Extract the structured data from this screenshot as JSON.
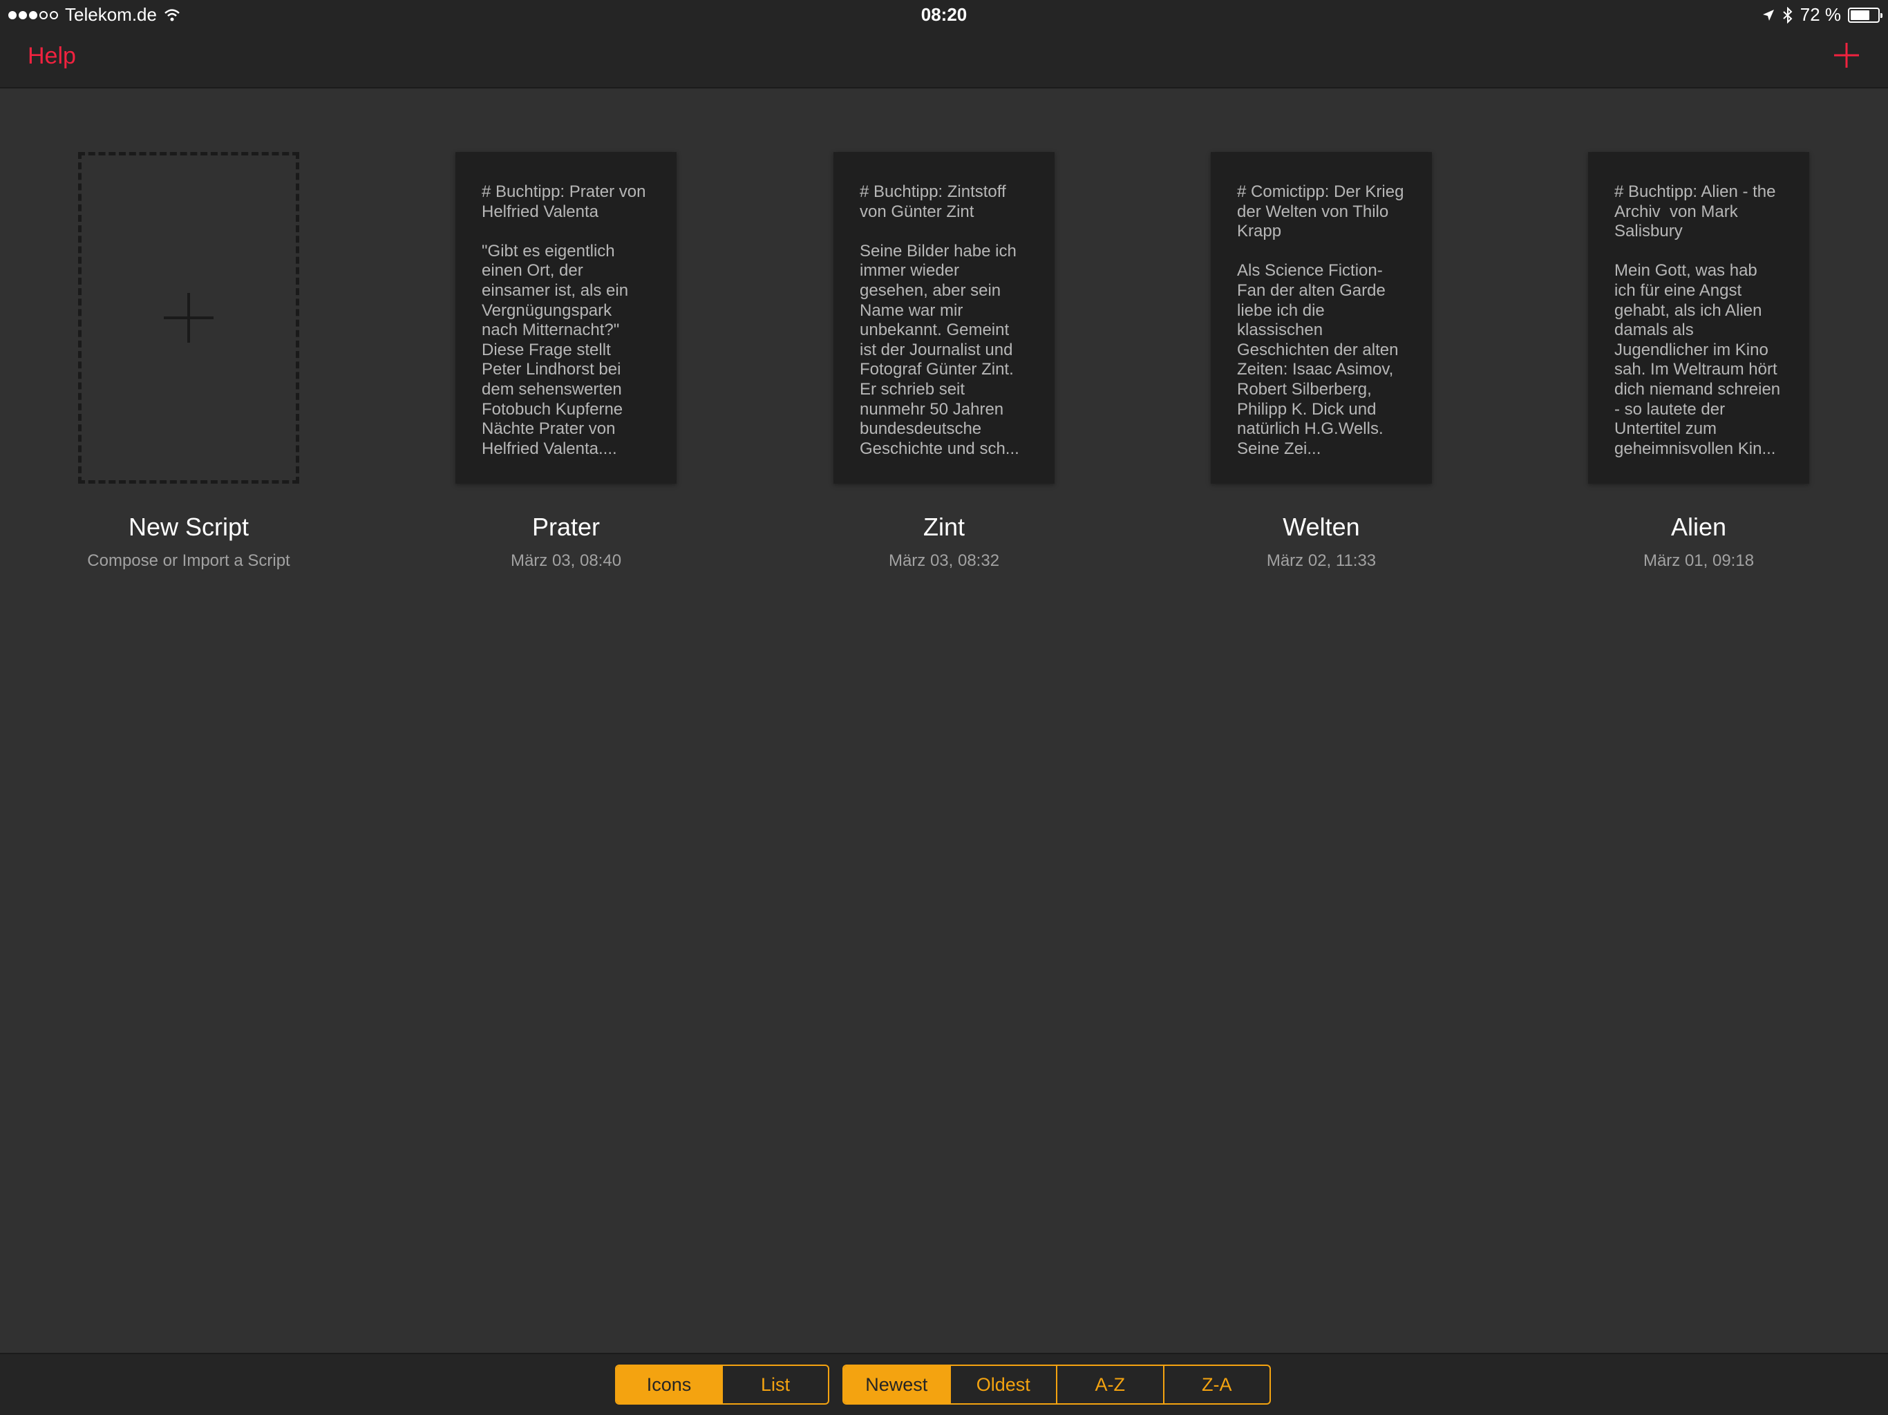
{
  "status_bar": {
    "carrier": "Telekom.de",
    "time": "08:20",
    "battery_text": "72 %",
    "battery_level": 0.72,
    "icons": [
      "signal-dots-icon",
      "wifi-icon",
      "location-arrow-icon",
      "bluetooth-icon",
      "battery-icon"
    ]
  },
  "nav": {
    "help_label": "Help",
    "add_icon": "plus-icon",
    "accent_color": "#f0223f"
  },
  "new_script": {
    "title": "New Script",
    "subtitle": "Compose or Import a Script"
  },
  "scripts": [
    {
      "preview": "# Buchtipp: Prater von Helfried Valenta\n\n\"Gibt es eigentlich einen Ort, der einsamer ist, als ein Vergnügungspark nach Mitternacht?\" Diese Frage stellt Peter Lindhorst bei dem sehenswerten Fotobuch Kupferne Nächte Prater von Helfried Valenta....",
      "title": "Prater",
      "date": "März 03, 08:40"
    },
    {
      "preview": "# Buchtipp: Zintstoff von Günter Zint\n\nSeine Bilder habe ich immer wieder gesehen, aber sein Name war mir unbekannt. Gemeint ist der Journalist und Fotograf Günter Zint. Er schrieb seit nunmehr 50 Jahren bundesdeutsche Geschichte und sch...",
      "title": "Zint",
      "date": "März 03, 08:32"
    },
    {
      "preview": "# Comictipp: Der Krieg der Welten von Thilo Krapp\n\nAls Science Fiction-Fan der alten Garde liebe ich die klassischen Geschichten der alten Zeiten: Isaac Asimov, Robert Silberberg, Philipp K. Dick und natürlich H.G.Wells. Seine Zei...",
      "title": "Welten",
      "date": "März 02, 11:33"
    },
    {
      "preview": "# Buchtipp: Alien - the Archiv  von Mark Salisbury\n\nMein Gott, was hab ich für eine Angst gehabt, als ich Alien damals als Jugendlicher im Kino sah. Im Weltraum hört dich niemand schreien - so lautete der Untertitel zum geheimnisvollen Kin...",
      "title": "Alien",
      "date": "März 01, 09:18"
    }
  ],
  "bottom": {
    "view_modes": [
      "Icons",
      "List"
    ],
    "active_view": "Icons",
    "sort_modes": [
      "Newest",
      "Oldest",
      "A-Z",
      "Z-A"
    ],
    "active_sort": "Newest",
    "accent_color": "#f4a310"
  }
}
